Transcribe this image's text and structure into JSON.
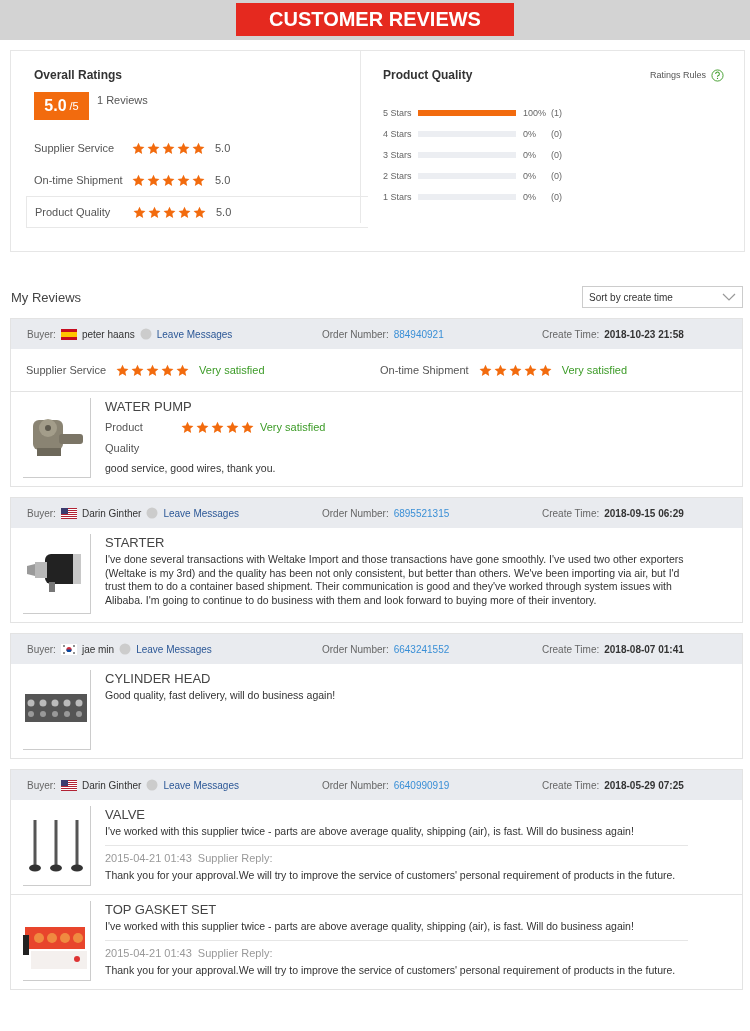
{
  "banner": {
    "title": "CUSTOMER REVIEWS"
  },
  "overall": {
    "title": "Overall Ratings",
    "score": "5.0",
    "out_of": "/5",
    "count": "1 Reviews",
    "items": [
      {
        "label": "Supplier Service",
        "stars": 5,
        "value": "5.0",
        "selected": false
      },
      {
        "label": "On-time Shipment",
        "stars": 5,
        "value": "5.0",
        "selected": false
      },
      {
        "label": "Product Quality",
        "stars": 5,
        "value": "5.0",
        "selected": true
      }
    ]
  },
  "quality": {
    "title": "Product Quality",
    "rules_link": "Ratings Rules",
    "rows": [
      {
        "label": "5 Stars",
        "level": 1,
        "percent": "100%",
        "count": "(1)"
      },
      {
        "label": "4 Stars",
        "level": 0,
        "percent": "0%",
        "count": "(0)"
      },
      {
        "label": "3 Stars",
        "level": 0,
        "percent": "0%",
        "count": "(0)"
      },
      {
        "label": "2 Stars",
        "level": 0,
        "percent": "0%",
        "count": "(0)"
      },
      {
        "label": "1 Stars",
        "level": 0,
        "percent": "0%",
        "count": "(0)"
      }
    ]
  },
  "reviews_header": {
    "title": "My Reviews",
    "sort": "Sort by create time"
  },
  "reviews": [
    {
      "buyer_label": "Buyer:",
      "buyer": "peter haans",
      "message_link": "Leave Messages",
      "order_label": "Order Number:",
      "order_number": "884940921",
      "time_label": "Create Time:",
      "time": "2018-10-23 21:58",
      "ratings": [
        {
          "label": "Supplier Service",
          "stars": 5,
          "verdict": "Very satisfied"
        },
        {
          "label": "On-time Shipment",
          "stars": 5,
          "verdict": "Very satisfied"
        }
      ],
      "products": [
        {
          "name": "WATER PUMP",
          "rating": {
            "label": "Product Quality",
            "stars": 5,
            "verdict": "Very satisfied"
          },
          "comment": "good service, good wires, thank you."
        }
      ]
    },
    {
      "buyer_label": "Buyer:",
      "buyer": "Darin Ginther",
      "message_link": "Leave Messages",
      "order_label": "Order Number:",
      "order_number": "6895521315",
      "time_label": "Create Time:",
      "time": "2018-09-15 06:29",
      "products": [
        {
          "name": "STARTER",
          "comment": "I've done several transactions with Weltake Import and those transactions have gone smoothly. I've used two other exporters (Weltake is my 3rd) and the quality has been not only consistent, but better than others. We've been importing via air, but I'd trust them to do a container based shipment. Their communication is good and they've worked through system issues with Alibaba. I'm going to continue to do business with them and look forward to buying more of their inventory."
        }
      ]
    },
    {
      "buyer_label": "Buyer:",
      "buyer": "jae min",
      "message_link": "Leave Messages",
      "order_label": "Order Number:",
      "order_number": "6643241552",
      "time_label": "Create Time:",
      "time": "2018-08-07 01:41",
      "products": [
        {
          "name": "CYLINDER HEAD",
          "comment": "Good quality, fast delivery, will do business again!"
        }
      ]
    },
    {
      "buyer_label": "Buyer:",
      "buyer": "Darin Ginther",
      "message_link": "Leave Messages",
      "order_label": "Order Number:",
      "order_number": "6640990919",
      "time_label": "Create Time:",
      "time": "2018-05-29 07:25",
      "products": [
        {
          "name": "VALVE",
          "comment": "I've worked with this supplier twice - parts are above average quality, shipping (air), is fast. Will do business again!",
          "reply": {
            "date": "2015-04-21 01:43",
            "label": "Supplier Reply:",
            "text": "Thank you for your approval.We will try to improve the service of customers' personal requirement of products in the future."
          }
        },
        {
          "name": "TOP GASKET SET",
          "comment": "I've worked with this supplier twice - parts are above average quality, shipping (air), is fast. Will do business again!",
          "reply": {
            "date": "2015-04-21 01:43",
            "label": "Supplier Reply:",
            "text": "Thank you for your approval.We will try to improve the service of customers' personal requirement of products in the future."
          }
        }
      ]
    }
  ]
}
